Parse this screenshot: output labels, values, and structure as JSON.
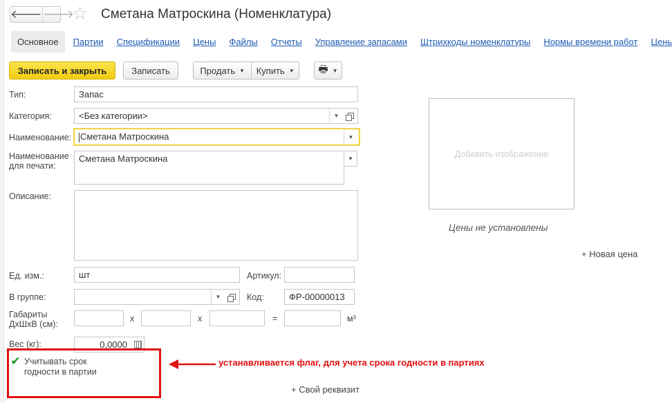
{
  "header": {
    "title": "Сметана Матроскина (Номенклатура)",
    "back_glyph": "🡐",
    "forward_glyph": "🡒",
    "star_glyph": "☆"
  },
  "tabs": [
    {
      "label": "Основное",
      "active": true
    },
    {
      "label": "Партии"
    },
    {
      "label": "Спецификации"
    },
    {
      "label": "Цены"
    },
    {
      "label": "Файлы"
    },
    {
      "label": "Отчеты"
    },
    {
      "label": "Управление запасами"
    },
    {
      "label": "Штрихкоды номенклатуры"
    },
    {
      "label": "Нормы времени работ"
    },
    {
      "label": "Цены кон"
    }
  ],
  "toolbar": {
    "save_close_label": "Записать и закрыть",
    "save_label": "Записать",
    "sell_label": "Продать",
    "buy_label": "Купить",
    "print_glyph": "🖶"
  },
  "form": {
    "type": {
      "label": "Тип:",
      "value": "Запас"
    },
    "category": {
      "label": "Категория:",
      "value": "<Без категории>"
    },
    "name": {
      "label": "Наименование:",
      "value": "Сметана Матроскина"
    },
    "print_name": {
      "label": "Наименование для печати:",
      "value": "Сметана Матроскина"
    },
    "description": {
      "label": "Описание:",
      "value": ""
    },
    "unit": {
      "label": "Ед. изм.:",
      "value": "шт"
    },
    "article": {
      "label": "Артикул:",
      "value": ""
    },
    "group": {
      "label": "В группе:",
      "value": ""
    },
    "code": {
      "label": "Код:",
      "value": "ФР-00000013"
    },
    "dimensions": {
      "label": "Габариты ДхШхВ (см):",
      "x1": "x",
      "x2": "x",
      "eq": "=",
      "unit": "м³"
    },
    "weight": {
      "label": "Вес (кг):",
      "value": "0,0000"
    },
    "expiry_checkbox": {
      "label": "Учитывать срок годности в партии",
      "checked": true
    }
  },
  "side": {
    "image_placeholder": "Добавить изображение",
    "prices_not_set": "Цены не установлены",
    "new_price_link": "+ Новая цена"
  },
  "custom_attr_link": "+ Свой реквизит",
  "annotation": {
    "text": "устанавливается флаг, для учета срока годности в партиях",
    "color": "#e01010"
  },
  "colors": {
    "primary_button": "#f2cc12",
    "link": "#1f5bb2",
    "focus_border": "#f0c820",
    "check": "#1a9a1a"
  }
}
